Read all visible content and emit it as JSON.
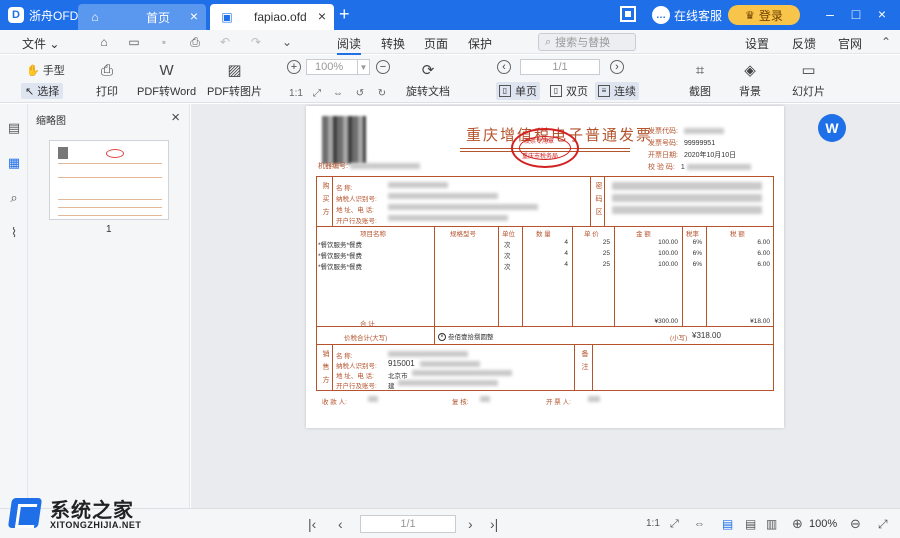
{
  "titlebar": {
    "app_name": "浙舟OFD",
    "tabs": [
      {
        "label": "首页",
        "icon": "home-icon"
      },
      {
        "label": "fapiao.ofd",
        "icon": "document-icon"
      }
    ],
    "service_label": "在线客服",
    "login_label": "登录"
  },
  "menubar": {
    "file_label": "文件",
    "items": [
      "阅读",
      "转换",
      "页面",
      "保护"
    ],
    "search_placeholder": "搜索与替换",
    "right_items": [
      "设置",
      "反馈",
      "官网"
    ]
  },
  "toolbar": {
    "hand_label": "手型",
    "select_label": "选择",
    "print_label": "打印",
    "pdf_word_label": "PDF转Word",
    "pdf_image_label": "PDF转图片",
    "zoom_value": "100%",
    "rotate_label": "旋转文档",
    "page_value": "1/1",
    "single_label": "单页",
    "double_label": "双页",
    "continuous_label": "连续",
    "screenshot_label": "截图",
    "background_label": "背景",
    "slideshow_label": "幻灯片"
  },
  "thumbs": {
    "title": "缩略图",
    "page_number": "1"
  },
  "invoice": {
    "title": "重庆增值税电子普通发票",
    "stamp_top": "发票专用章",
    "stamp_bottom": "重庆市税务局",
    "meta": {
      "code_label": "发票代码:",
      "number_label": "发票号码:",
      "number_value": "99999951",
      "date_label": "开票日期:",
      "date_value": "2020年10月10日",
      "check_label": "校 验 码:",
      "check_value": "1"
    },
    "machine_label": "机器编号:",
    "buyer": {
      "side": "购买方",
      "name": "名 称:",
      "tax": "纳税人识别号:",
      "addr": "地 址、电 话:",
      "bank": "开户行及账号:"
    },
    "cipher_side": "密码区",
    "columns": [
      "项目名称",
      "规格型号",
      "单位",
      "数 量",
      "单 价",
      "金 额",
      "税率",
      "税 额"
    ],
    "rows": [
      {
        "name": "*餐饮服务*餐费",
        "unit": "次",
        "qty": "4",
        "price": "25",
        "amount": "100.00",
        "rate": "6%",
        "tax": "6.00"
      },
      {
        "name": "*餐饮服务*餐费",
        "unit": "次",
        "qty": "4",
        "price": "25",
        "amount": "100.00",
        "rate": "6%",
        "tax": "6.00"
      },
      {
        "name": "*餐饮服务*餐费",
        "unit": "次",
        "qty": "4",
        "price": "25",
        "amount": "100.00",
        "rate": "6%",
        "tax": "6.00"
      }
    ],
    "total_label": "合 计",
    "total_amount": "¥300.00",
    "total_tax": "¥18.00",
    "sum_label": "价税合计(大写)",
    "sum_words": "叁佰壹拾捌圆整",
    "sum_small_label": "(小写)",
    "sum_small": "¥318.00",
    "seller": {
      "side": "销售方",
      "name": "名 称:",
      "tax": "纳税人识别号:",
      "tax_value": "915001",
      "addr": "地 址、电 话:",
      "addr_value": "北京市",
      "bank": "开户行及账号:",
      "bank_value": "建"
    },
    "remark_side": "备注",
    "payee_label": "收 款 人:",
    "reviewer_label": "复 核:",
    "drawer_label": "开 票 人:"
  },
  "bottombar": {
    "page_value": "1/1",
    "zoom_value": "100%"
  },
  "watermark": {
    "title": "系统之家",
    "subtitle": "XITONGZHIJIA.NET"
  },
  "colors": {
    "accent": "#1e6fe8",
    "invoice": "#b5532d",
    "stamp": "#d32020",
    "login": "#f8c54a"
  }
}
